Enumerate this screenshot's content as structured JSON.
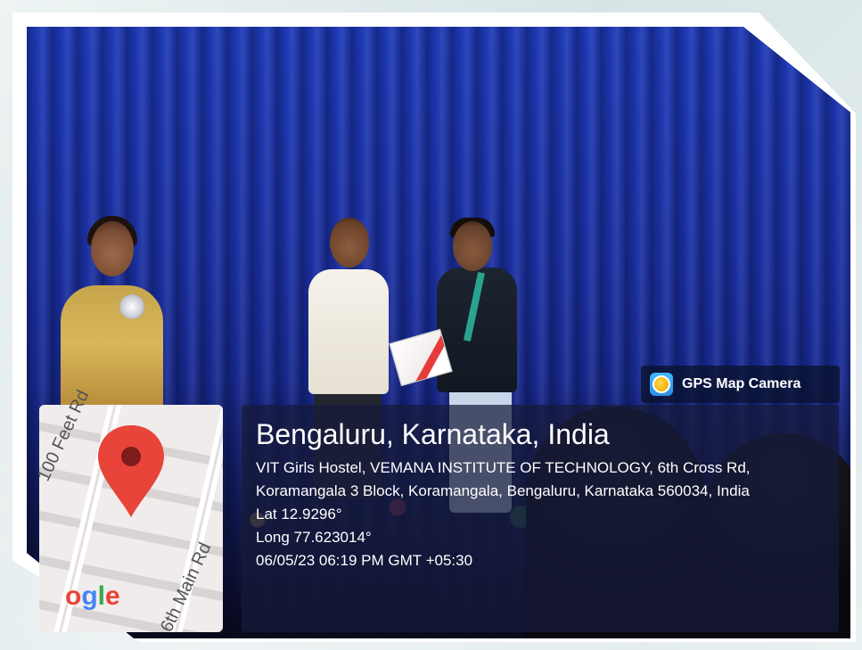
{
  "watermark": {
    "app_label": "GPS Map Camera",
    "app_icon": "gps-map-camera-icon"
  },
  "location": {
    "title": "Bengaluru, Karnataka, India",
    "address": "VIT Girls Hostel, VEMANA INSTITUTE OF TECHNOLOGY, 6th Cross Rd, Koramangala 3 Block, Koramangala, Bengaluru, Karnataka 560034, India",
    "latitude": "Lat 12.9296°",
    "longitude": "Long 77.623014°",
    "datetime": "06/05/23 06:19 PM GMT +05:30"
  },
  "map": {
    "road1": "100 Feet Rd",
    "road2": "6th Main Rd",
    "logo_text": "ogle",
    "pin_color": "#e8443a"
  },
  "colors": {
    "curtain": "#1d39b8",
    "overlay_bg": "#161a3a"
  }
}
